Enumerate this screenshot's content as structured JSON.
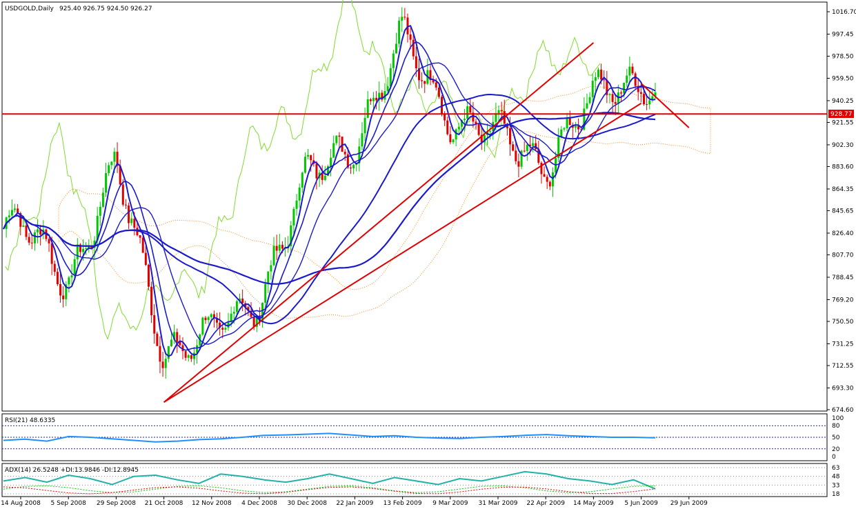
{
  "header": {
    "symbol": "USDGOLD,Daily",
    "ohlc": "925.40 926.75 924.50 926.27"
  },
  "rsi": {
    "label": "RSI(21) 48.6335",
    "levels": [
      "100",
      "80",
      "50",
      "20",
      "0"
    ]
  },
  "adx": {
    "label": "ADX(14) 26.5248 +DI:13.9846 -DI:12.8945",
    "levels": [
      "63",
      "48",
      "33",
      "18"
    ]
  },
  "current_price": "928.77",
  "colors": {
    "bull": "#00c800",
    "bear": "#e00000",
    "ma": "#1a1acc",
    "trend": "#e00000",
    "cloud": "#f08a20",
    "cloud_alt": "#b0b0b0",
    "chikou": "#7fdc2a",
    "rsi": "#1e90ff",
    "adx": "#20b2aa",
    "level_line": "#1a1acc"
  },
  "chart_data": [
    {
      "type": "candlestick",
      "title": "USDGOLD,Daily",
      "ylim": [
        674.6,
        1025
      ],
      "y_ticks": [
        "1016.70",
        "997.45",
        "978.50",
        "959.50",
        "940.25",
        "921.55",
        "902.30",
        "883.60",
        "864.35",
        "845.65",
        "826.40",
        "807.70",
        "788.45",
        "769.20",
        "750.50",
        "731.25",
        "712.55",
        "693.30",
        "674.60"
      ],
      "x_ticks": [
        "14 Aug 2008",
        "5 Sep 2008",
        "29 Sep 2008",
        "21 Oct 2008",
        "12 Nov 2008",
        "4 Dec 2008",
        "30 Dec 2008",
        "22 Jan 2009",
        "13 Feb 2009",
        "9 Mar 2009",
        "31 Mar 2009",
        "22 Apr 2009",
        "14 May 2009",
        "5 Jun 2009",
        "29 Jun 2009"
      ],
      "approx_close_path": [
        [
          "14 Aug 2008",
          830
        ],
        [
          "5 Sep 2008",
          790
        ],
        [
          "29 Sep 2008",
          880
        ],
        [
          "21 Oct 2008",
          730
        ],
        [
          "12 Nov 2008",
          735
        ],
        [
          "4 Dec 2008",
          775
        ],
        [
          "30 Dec 2008",
          870
        ],
        [
          "22 Jan 2009",
          910
        ],
        [
          "13 Feb 2009",
          990
        ],
        [
          "9 Mar 2009",
          930
        ],
        [
          "31 Mar 2009",
          905
        ],
        [
          "22 Apr 2009",
          890
        ],
        [
          "14 May 2009",
          940
        ],
        [
          "5 Jun 2009",
          965
        ],
        [
          "29 Jun 2009",
          926.27
        ]
      ],
      "horizontal_line": 928.77,
      "trendlines": [
        {
          "from": [
            "21 Oct 2008",
            681
          ],
          "to": [
            "14 May 2009",
            990
          ]
        },
        {
          "from": [
            "21 Oct 2008",
            681
          ],
          "to": [
            "5 Jun 2009",
            938
          ]
        },
        {
          "from": [
            "5 Jun 2009",
            955
          ],
          "to": [
            "29 Jun 2009",
            917
          ]
        }
      ]
    },
    {
      "type": "line",
      "title": "RSI(21) 48.6335",
      "ylim": [
        0,
        100
      ],
      "levels": [
        80,
        50,
        20
      ],
      "series": [
        {
          "name": "RSI(21)",
          "values": [
            42,
            45,
            40,
            52,
            50,
            46,
            42,
            38,
            40,
            44,
            46,
            50,
            55,
            56,
            58,
            60,
            56,
            52,
            54,
            50,
            48,
            47,
            50,
            52,
            55,
            57,
            54,
            52,
            50,
            50,
            48.63
          ]
        }
      ]
    },
    {
      "type": "line",
      "title": "ADX(14) 26.5248 +DI:13.9846 -DI:12.8945",
      "ylim": [
        18,
        63
      ],
      "levels": [
        63,
        48,
        33,
        18
      ],
      "series": [
        {
          "name": "ADX(14)",
          "values": [
            40,
            46,
            38,
            50,
            44,
            34,
            48,
            50,
            42,
            36,
            52,
            48,
            42,
            38,
            44,
            52,
            44,
            36,
            46,
            40,
            34,
            44,
            40,
            48,
            56,
            52,
            44,
            40,
            34,
            42,
            26.52
          ]
        }
      ]
    }
  ]
}
